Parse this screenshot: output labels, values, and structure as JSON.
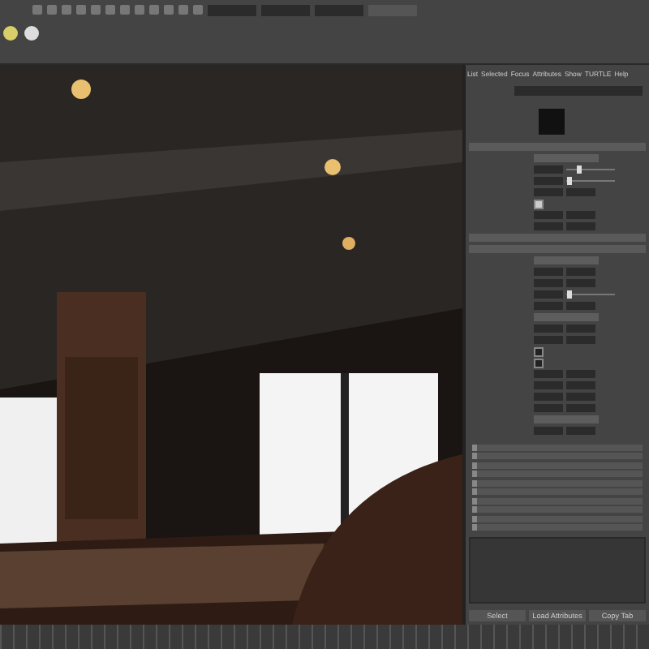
{
  "attribute_editor": {
    "menu_tabs": [
      "List",
      "Selected",
      "Focus",
      "Attributes",
      "Show",
      "TURTLE",
      "Help"
    ],
    "rows_top": [
      {
        "kind": "dropdown"
      },
      {
        "kind": "slider",
        "level": 0.25
      },
      {
        "kind": "slider",
        "level": 0.05
      },
      {
        "kind": "field"
      },
      {
        "kind": "checkbox",
        "checked": true
      },
      {
        "kind": "field"
      },
      {
        "kind": "field"
      }
    ],
    "rows_main": [
      {
        "kind": "dropdown"
      },
      {
        "kind": "field"
      },
      {
        "kind": "field"
      },
      {
        "kind": "slider",
        "level": 0.05
      },
      {
        "kind": "field"
      },
      {
        "kind": "dropdown"
      },
      {
        "kind": "field"
      },
      {
        "kind": "field"
      },
      {
        "kind": "checkbox",
        "checked": false
      },
      {
        "kind": "checkbox",
        "checked": false
      },
      {
        "kind": "field"
      },
      {
        "kind": "field"
      },
      {
        "kind": "field"
      },
      {
        "kind": "field"
      },
      {
        "kind": "dropdown"
      },
      {
        "kind": "field"
      }
    ],
    "collapsed_sections": [
      {
        "expanded": false
      },
      {
        "expanded": false
      },
      {
        "expanded": false
      },
      {
        "expanded": false
      },
      {
        "expanded": false
      },
      {
        "expanded": false
      },
      {
        "expanded": false
      },
      {
        "expanded": false
      },
      {
        "expanded": false
      },
      {
        "expanded": false
      }
    ],
    "buttons": [
      "Select",
      "Load Attributes",
      "Copy Tab"
    ]
  }
}
